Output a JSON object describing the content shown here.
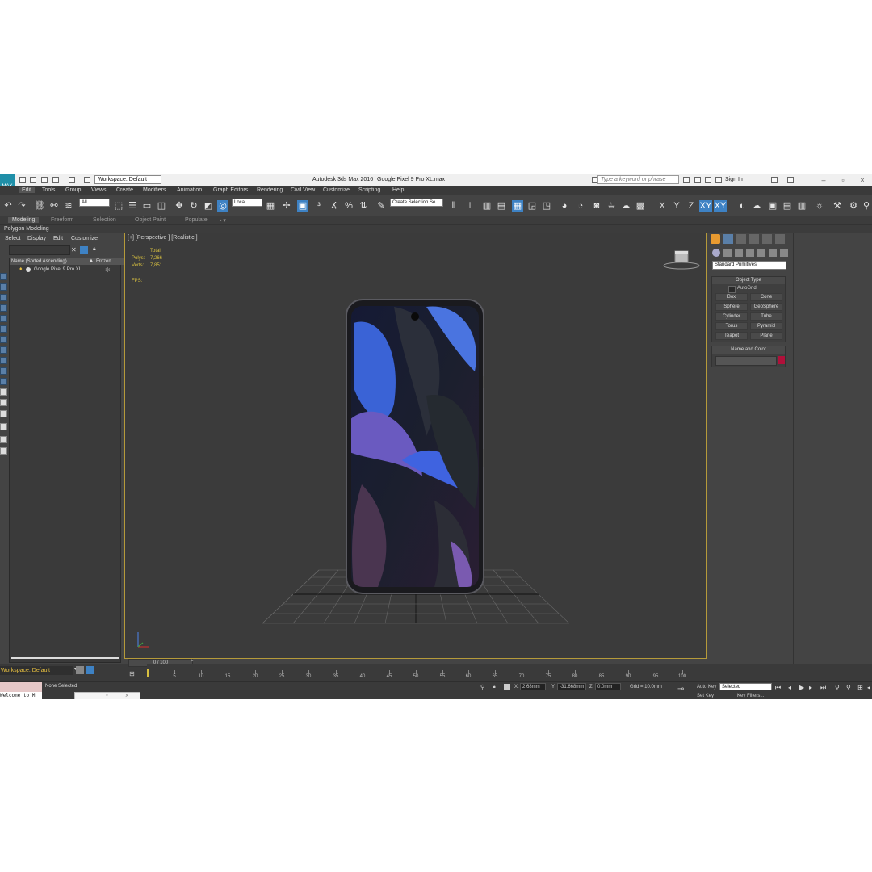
{
  "titlebar": {
    "app_badge": "MAX",
    "workspace": "Workspace: Default",
    "app_title": "Autodesk 3ds Max 2016",
    "file_name": "Google Pixel 9 Pro XL.max",
    "search_placeholder": "Type a keyword or phrase",
    "sign_in": "Sign In"
  },
  "menu": [
    "Edit",
    "Tools",
    "Group",
    "Views",
    "Create",
    "Modifiers",
    "Animation",
    "Graph Editors",
    "Rendering",
    "Civil View",
    "Customize",
    "Scripting",
    "Help"
  ],
  "toolbar": {
    "selection_filter": "All",
    "ref_coord": "Local",
    "named_selection": "Create Selection Se",
    "axes": [
      "X",
      "Y",
      "Z",
      "XY",
      "XY"
    ]
  },
  "ribbon": {
    "tabs": [
      "Modeling",
      "Freeform",
      "Selection",
      "Object Paint",
      "Populate"
    ],
    "panel": "Polygon Modeling"
  },
  "explorer": {
    "menus": [
      "Select",
      "Display",
      "Edit",
      "Customize"
    ],
    "col_name": "Name (Sorted Ascending)",
    "col_frozen": "Frozen",
    "rows": [
      "Google Pixel 9 Pro XL"
    ],
    "workspace": "Workspace: Default"
  },
  "viewport": {
    "label": "[+] [Perspective ] [Realistic ]",
    "stats_header": "Total",
    "polys_label": "Polys:",
    "polys_value": "7,266",
    "verts_label": "Verts:",
    "verts_value": "7,851",
    "fps_label": "FPS:"
  },
  "command_panel": {
    "dropdown": "Standard Primitives",
    "object_type_title": "Object Type",
    "autogrid": "AutoGrid",
    "buttons": [
      "Box",
      "Cone",
      "Sphere",
      "GeoSphere",
      "Cylinder",
      "Tube",
      "Torus",
      "Pyramid",
      "Teapot",
      "Plane"
    ],
    "name_color_title": "Name and Color",
    "object_color": "#b0103a"
  },
  "timeline": {
    "frame": "0 / 100",
    "ticks": [
      "5",
      "10",
      "15",
      "20",
      "25",
      "30",
      "35",
      "40",
      "45",
      "50",
      "55",
      "60",
      "65",
      "70",
      "75",
      "80",
      "85",
      "90",
      "95",
      "100"
    ]
  },
  "status": {
    "script_text": "Welcome to M",
    "selection_text": "None Selected",
    "x_label": "X:",
    "x_value": "2.68mm",
    "y_label": "Y:",
    "y_value": "-31.668mm",
    "z_label": "Z:",
    "z_value": "0.0mm",
    "grid": "Grid = 10.0mm",
    "auto_key": "Auto Key",
    "set_key": "Set Key",
    "selected": "Selected",
    "key_filters": "Key Filters..."
  },
  "colors": {
    "accent_blue": "#3e82c4",
    "viewport_border": "#b59a3a",
    "stats_yellow": "#d8c040"
  }
}
